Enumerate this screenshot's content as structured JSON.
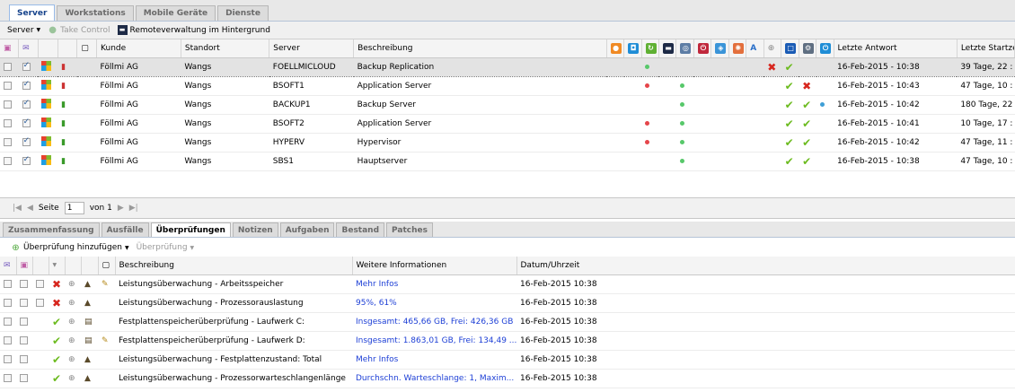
{
  "tabs": [
    "Server",
    "Workstations",
    "Mobile Geräte",
    "Dienste"
  ],
  "toolbar": {
    "server_menu": "Server",
    "take_control": "Take Control",
    "remote_label": "Remoteverwaltung im Hintergrund"
  },
  "server_table": {
    "headers": {
      "kunde": "Kunde",
      "standort": "Standort",
      "server": "Server",
      "beschreibung": "Beschreibung",
      "letzte_antwort": "Letzte Antwort",
      "letzte_startzeit": "Letzte Startze"
    },
    "rows": [
      {
        "kunde": "Föllmi AG",
        "standort": "Wangs",
        "server": "FOELLMICLOUD",
        "beschreibung": "Backup Replication",
        "antwort": "16-Feb-2015 - 10:38",
        "startzeit": "39 Tage, 22 :"
      },
      {
        "kunde": "Föllmi AG",
        "standort": "Wangs",
        "server": "BSOFT1",
        "beschreibung": "Application Server",
        "antwort": "16-Feb-2015 - 10:43",
        "startzeit": "47 Tage, 10 :"
      },
      {
        "kunde": "Föllmi AG",
        "standort": "Wangs",
        "server": "BACKUP1",
        "beschreibung": "Backup Server",
        "antwort": "16-Feb-2015 - 10:42",
        "startzeit": "180 Tage, 22"
      },
      {
        "kunde": "Föllmi AG",
        "standort": "Wangs",
        "server": "BSOFT2",
        "beschreibung": "Application Server",
        "antwort": "16-Feb-2015 - 10:41",
        "startzeit": "10 Tage, 17 :"
      },
      {
        "kunde": "Föllmi AG",
        "standort": "Wangs",
        "server": "HYPERV",
        "beschreibung": "Hypervisor",
        "antwort": "16-Feb-2015 - 10:42",
        "startzeit": "47 Tage, 11 :"
      },
      {
        "kunde": "Föllmi AG",
        "standort": "Wangs",
        "server": "SBS1",
        "beschreibung": "Hauptserver",
        "antwort": "16-Feb-2015 - 10:38",
        "startzeit": "47 Tage, 10 :"
      }
    ]
  },
  "pager": {
    "seite": "Seite",
    "page": "1",
    "von": "von 1"
  },
  "detail_tabs": [
    "Zusammenfassung",
    "Ausfälle",
    "Überprüfungen",
    "Notizen",
    "Aufgaben",
    "Bestand",
    "Patches"
  ],
  "detail_toolbar": {
    "add": "Überprüfung hinzufügen",
    "check": "Überprüfung"
  },
  "checks_table": {
    "headers": {
      "beschreibung": "Beschreibung",
      "info": "Weitere Informationen",
      "datum": "Datum/Uhrzeit"
    },
    "rows": [
      {
        "beschreibung": "Leistungsüberwachung - Arbeitsspeicher",
        "info": "Mehr Infos",
        "datum": "16-Feb-2015 10:38"
      },
      {
        "beschreibung": "Leistungsüberwachung - Prozessorauslastung",
        "info": "95%, 61%",
        "datum": "16-Feb-2015 10:38"
      },
      {
        "beschreibung": "Festplattenspeicherüberprüfung - Laufwerk C:",
        "info": "Insgesamt: 465,66 GB, Frei: 426,36 GB",
        "datum": "16-Feb-2015 10:38"
      },
      {
        "beschreibung": "Festplattenspeicherüberprüfung - Laufwerk D:",
        "info": "Insgesamt: 1.863,01 GB, Frei: 134,49 ...",
        "datum": "16-Feb-2015 10:38"
      },
      {
        "beschreibung": "Leistungsüberwachung - Festplattenzustand: Total",
        "info": "Mehr Infos",
        "datum": "16-Feb-2015 10:38"
      },
      {
        "beschreibung": "Leistungsüberwachung - Prozessorwarteschlangenlänge",
        "info": "Durchschn. Warteschlange: 1, Maxim...",
        "datum": "16-Feb-2015 10:38"
      }
    ]
  }
}
